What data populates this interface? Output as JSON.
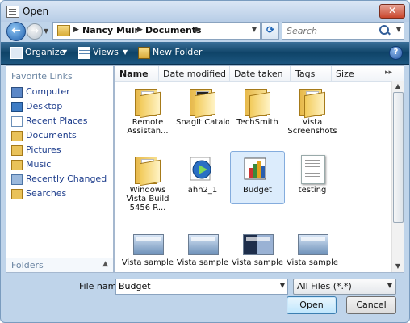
{
  "window": {
    "title": "Open",
    "close_glyph": "✕"
  },
  "nav": {
    "back_glyph": "←",
    "forward_glyph": "→",
    "address": {
      "segments": [
        "Nancy Muir",
        "Documents"
      ]
    },
    "refresh_glyph": "⟳",
    "search": {
      "placeholder": "Search"
    }
  },
  "toolbar": {
    "organize": "Organize",
    "views": "Views",
    "new_folder": "New Folder",
    "help": "?"
  },
  "sidebar": {
    "header": "Favorite Links",
    "items": [
      {
        "label": "Computer",
        "icon": "computer-icon"
      },
      {
        "label": "Desktop",
        "icon": "desktop-icon"
      },
      {
        "label": "Recent Places",
        "icon": "recent-places-icon"
      },
      {
        "label": "Documents",
        "icon": "documents-icon"
      },
      {
        "label": "Pictures",
        "icon": "pictures-icon"
      },
      {
        "label": "Music",
        "icon": "music-icon"
      },
      {
        "label": "Recently Changed",
        "icon": "recently-changed-icon"
      },
      {
        "label": "Searches",
        "icon": "searches-icon"
      }
    ],
    "folders_label": "Folders"
  },
  "columns": [
    "Name",
    "Date modified",
    "Date taken",
    "Tags",
    "Size"
  ],
  "files": [
    {
      "label": "Remote Assistan...",
      "kind": "folder"
    },
    {
      "label": "SnagIt Catalog",
      "kind": "folder"
    },
    {
      "label": "TechSmith",
      "kind": "folder"
    },
    {
      "label": "Vista Screenshots",
      "kind": "folder"
    },
    {
      "label": "Windows Vista Build 5456 R...",
      "kind": "folder"
    },
    {
      "label": "ahh2_1",
      "kind": "media"
    },
    {
      "label": "Budget",
      "kind": "spreadsheet",
      "selected": true
    },
    {
      "label": "testing",
      "kind": "document"
    },
    {
      "label": "Vista sample",
      "kind": "image"
    },
    {
      "label": "Vista sample",
      "kind": "image"
    },
    {
      "label": "Vista sample",
      "kind": "image"
    },
    {
      "label": "Vista sample",
      "kind": "image"
    }
  ],
  "footer": {
    "file_name_label": "File name:",
    "file_name_value": "Budget",
    "file_type": "All Files (*.*)",
    "open_button": "Open",
    "cancel_button": "Cancel"
  },
  "colors": {
    "toolbar": "#1d5680",
    "selection": "#dcecfc",
    "link": "#1d3d8c"
  }
}
